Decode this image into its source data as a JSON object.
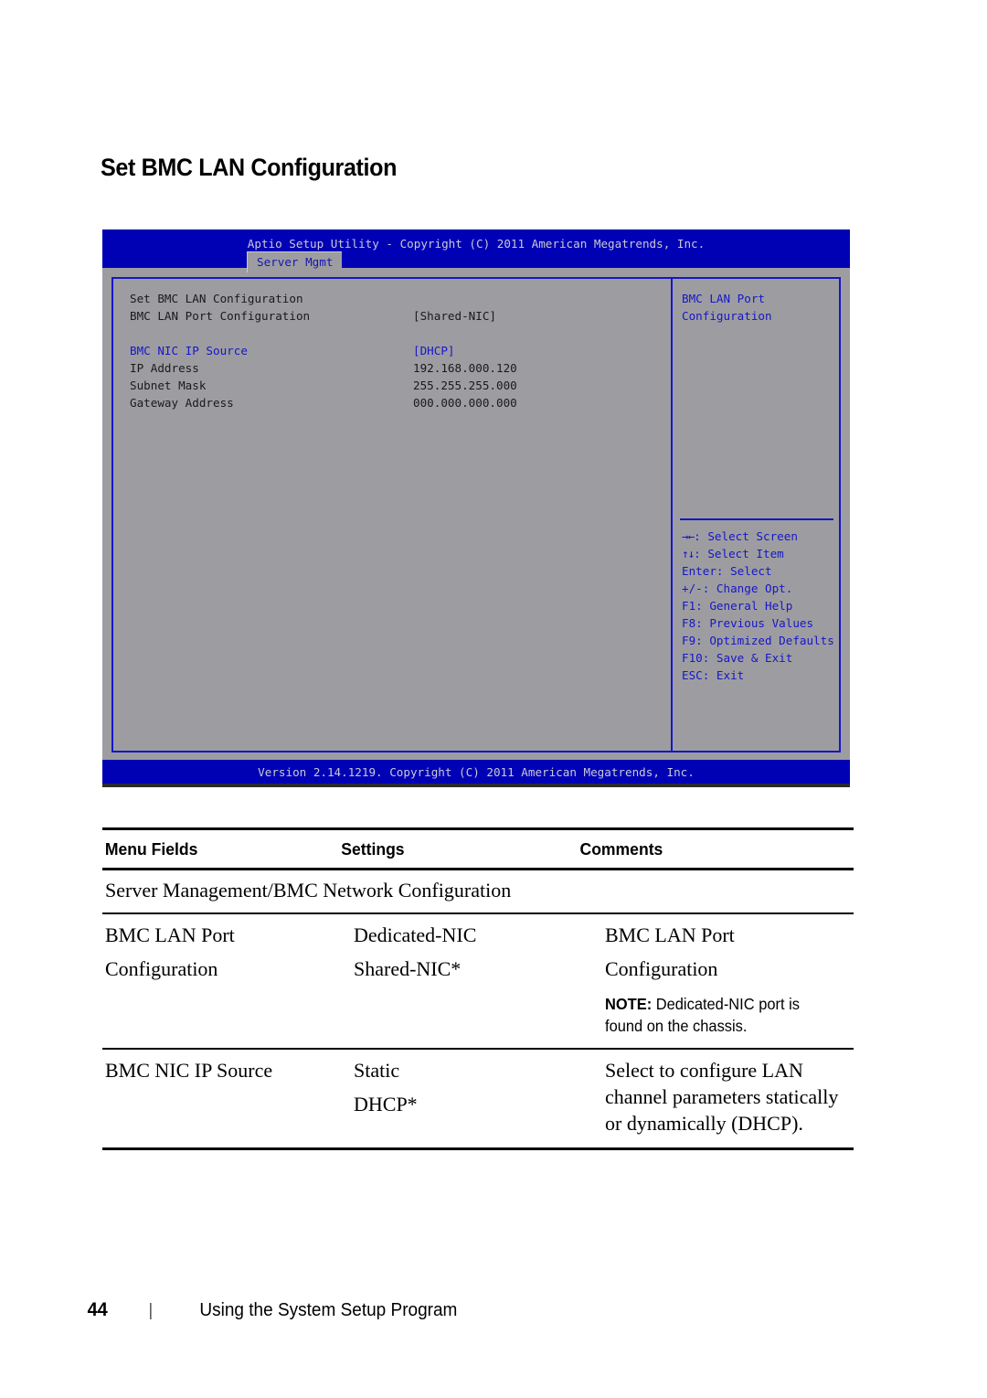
{
  "page_title": "Set BMC LAN Configuration",
  "bios": {
    "header_title": "Aptio Setup Utility - Copyright (C) 2011 American Megatrends, Inc.",
    "tab_label": "Server Mgmt",
    "rows": [
      {
        "label": "Set BMC LAN Configuration",
        "value": "",
        "selected": false
      },
      {
        "label": "BMC LAN Port Configuration",
        "value": "[Shared-NIC]",
        "selected": false
      },
      {
        "label": "",
        "value": "",
        "selected": false
      },
      {
        "label": "BMC NIC IP Source",
        "value": "[DHCP]",
        "selected": true
      },
      {
        "label": "IP Address",
        "value": "192.168.000.120",
        "selected": false
      },
      {
        "label": "Subnet Mask",
        "value": "255.255.255.000",
        "selected": false
      },
      {
        "label": "Gateway Address",
        "value": "000.000.000.000",
        "selected": false
      }
    ],
    "help": [
      "BMC LAN Port",
      "Configuration"
    ],
    "keys": [
      {
        "glyph": "→←",
        "text": ": Select Screen"
      },
      {
        "glyph": "↑↓",
        "text": ": Select Item"
      },
      {
        "glyph": "",
        "text": "Enter: Select"
      },
      {
        "glyph": "",
        "text": "+/-: Change Opt."
      },
      {
        "glyph": "",
        "text": "F1: General Help"
      },
      {
        "glyph": "",
        "text": "F8: Previous Values"
      },
      {
        "glyph": "",
        "text": "F9: Optimized Defaults"
      },
      {
        "glyph": "",
        "text": "F10: Save & Exit"
      },
      {
        "glyph": "",
        "text": "ESC: Exit"
      }
    ],
    "footer_text": "Version 2.14.1219. Copyright (C) 2011 American Megatrends, Inc.",
    "colors": {
      "header_blue": "#0000b4",
      "panel_gray": "#9d9da1",
      "border_blue": "#1616c8",
      "highlight_blue": "#1616c8"
    }
  },
  "table": {
    "headers": [
      "Menu Fields",
      "Settings",
      "Comments"
    ],
    "section": "Server Management/BMC Network Configuration",
    "rows": [
      {
        "field_lines": [
          "BMC LAN Port",
          "Configuration"
        ],
        "setting_lines": [
          "Dedicated-NIC",
          "Shared-NIC*"
        ],
        "comment_lines": [
          "BMC LAN Port",
          "Configuration"
        ],
        "note_bold": "NOTE:",
        "note_text": " Dedicated-NIC port is found on the chassis."
      },
      {
        "field_lines": [
          "BMC NIC IP Source"
        ],
        "setting_lines": [
          "Static",
          "DHCP*"
        ],
        "comment_lines": [
          "Select to configure LAN channel parameters statically or dynamically (DHCP)."
        ],
        "note_bold": "",
        "note_text": ""
      }
    ]
  },
  "footer": {
    "page_number": "44",
    "separator": "|",
    "section_title": "Using the System Setup Program"
  }
}
